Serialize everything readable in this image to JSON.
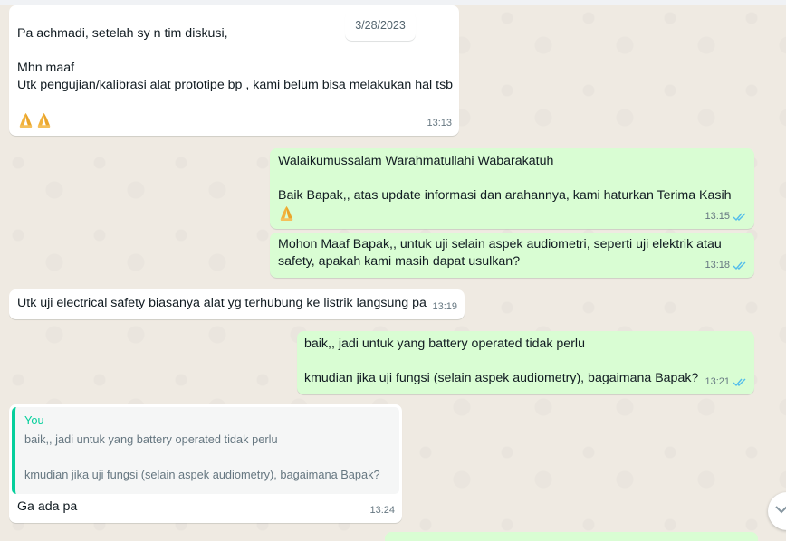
{
  "date_chip": "3/28/2023",
  "messages": [
    {
      "direction": "in",
      "text": "Pa achmadi, setelah sy n tim diskusi,\n\nMhn maaf\nUtk pengujian/kalibrasi alat prototipe bp , kami belum bisa melakukan hal tsb\n\n",
      "emoji": "folded-hands x2",
      "time": "13:13"
    },
    {
      "direction": "out",
      "text": "Walaikumussalam Warahmatullahi Wabarakatuh\n\nBaik Bapak,, atas update informasi dan arahannya, kami haturkan Terima Kasih\n",
      "emoji": "folded-hands",
      "time": "13:15",
      "status": "read"
    },
    {
      "direction": "out",
      "text": "Mohon Maaf Bapak,, untuk uji selain aspek audiometri, seperti uji elektrik atau safety, apakah kami masih dapat usulkan?",
      "time": "13:18",
      "status": "read"
    },
    {
      "direction": "in",
      "text": "Utk uji electrical safety biasanya alat yg terhubung ke listrik langsung pa",
      "time": "13:19"
    },
    {
      "direction": "out",
      "text": "baik,, jadi untuk yang battery operated tidak perlu\n\nkmudian jika uji fungsi (selain aspek audiometry), bagaimana Bapak?",
      "time": "13:21",
      "status": "read"
    },
    {
      "direction": "in",
      "quote": {
        "author": "You",
        "text": "baik,, jadi untuk yang battery operated tidak perlu\n\nkmudian jika uji fungsi (selain aspek audiometry), bagaimana Bapak?"
      },
      "text": "Ga ada pa",
      "time": "13:24"
    }
  ],
  "colors": {
    "wallpaper": "#efeae2",
    "incoming": "#ffffff",
    "outgoing": "#d9fdd3",
    "read_ticks": "#53bdeb",
    "quote_accent": "#06cf9c"
  },
  "icons": {
    "read_status": "double-check-icon",
    "emoji": "folded-hands-emoji",
    "scroll": "chevron-down-icon"
  }
}
